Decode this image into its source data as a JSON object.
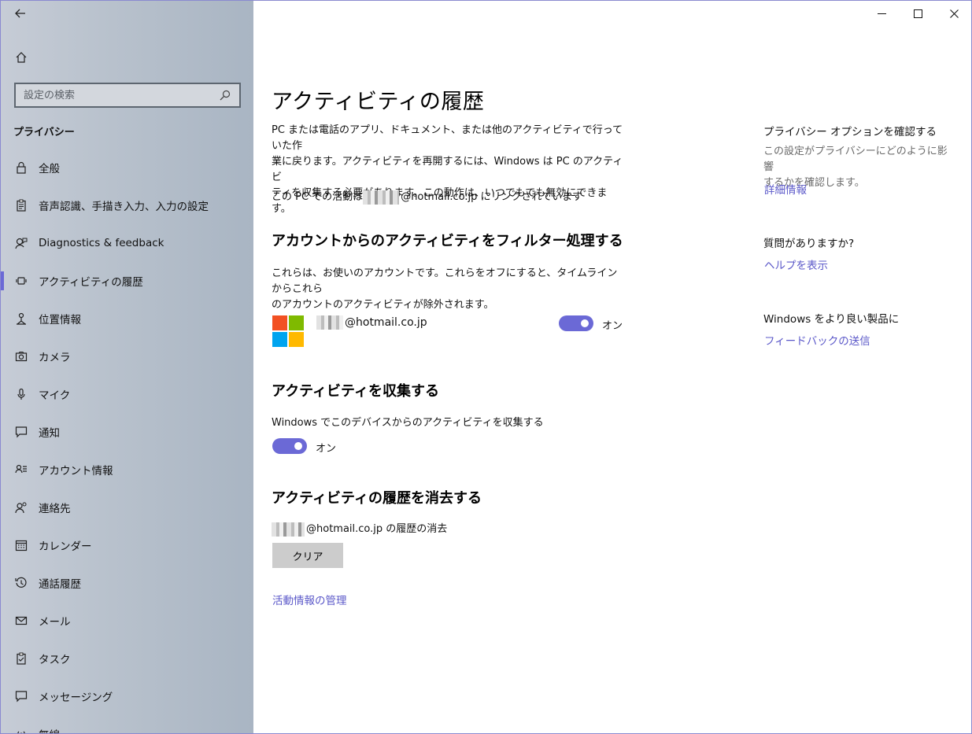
{
  "sidebar": {
    "search_placeholder": "設定の検索",
    "heading": "プライバシー",
    "items": [
      {
        "label": "全般",
        "icon": "lock-icon"
      },
      {
        "label": "音声認識、手描き入力、入力の設定",
        "icon": "clipboard-icon"
      },
      {
        "label": "Diagnostics & feedback",
        "icon": "feedback-person-icon"
      },
      {
        "label": "アクティビティの履歴",
        "icon": "activity-icon",
        "active": true
      },
      {
        "label": "位置情報",
        "icon": "location-person-icon"
      },
      {
        "label": "カメラ",
        "icon": "camera-icon"
      },
      {
        "label": "マイク",
        "icon": "microphone-icon"
      },
      {
        "label": "通知",
        "icon": "chat-bubble-icon"
      },
      {
        "label": "アカウント情報",
        "icon": "account-info-icon"
      },
      {
        "label": "連絡先",
        "icon": "contacts-icon"
      },
      {
        "label": "カレンダー",
        "icon": "calendar-icon"
      },
      {
        "label": "通話履歴",
        "icon": "history-icon"
      },
      {
        "label": "メール",
        "icon": "mail-icon"
      },
      {
        "label": "タスク",
        "icon": "task-icon"
      },
      {
        "label": "メッセージング",
        "icon": "message-icon"
      },
      {
        "label": "無線",
        "icon": "radio-icon"
      }
    ]
  },
  "main": {
    "title": "アクティビティの履歴",
    "intro_line1": "PC または電話のアプリ、ドキュメント、または他のアクティビティで行っていた作",
    "intro_line2": "業に戻ります。アクティビティを再開するには、Windows は PC のアクティビ",
    "intro_line3": "ティを収集する必要があります。この動作は、いつでもでも無効にできます。",
    "link_status_prefix": "この PC での活動は",
    "link_status_suffix": "@hotmail.co.jp にリンクされています",
    "filter_heading": "アカウントからのアクティビティをフィルター処理する",
    "filter_desc_line1": "これらは、お使いのアカウントです。これらをオフにすると、タイムラインからこれら",
    "filter_desc_line2": "のアカウントのアクティビティが除外されます。",
    "account_email_suffix": "@hotmail.co.jp",
    "account_toggle_label": "オン",
    "collect_heading": "アクティビティを収集する",
    "collect_desc": "Windows でこのデバイスからのアクティビティを収集する",
    "collect_toggle_label": "オン",
    "clear_heading": "アクティビティの履歴を消去する",
    "clear_desc_suffix": "@hotmail.co.jp の履歴の消去",
    "clear_button": "クリア",
    "manage_link": "活動情報の管理"
  },
  "right": {
    "privacy_heading": "プライバシー オプションを確認する",
    "privacy_desc_line1": "この設定がプライバシーにどのように影響",
    "privacy_desc_line2": "するかを確認します。",
    "privacy_link": "詳細情報",
    "question_heading": "質問がありますか?",
    "help_link": "ヘルプを表示",
    "improve_heading": "Windows をより良い製品に",
    "feedback_link": "フィードバックの送信"
  },
  "colors": {
    "accent": "#6b69d6",
    "link": "#5b58c9",
    "ms_red": "#f25022",
    "ms_green": "#7fba00",
    "ms_blue": "#00a4ef",
    "ms_yellow": "#ffb900"
  }
}
